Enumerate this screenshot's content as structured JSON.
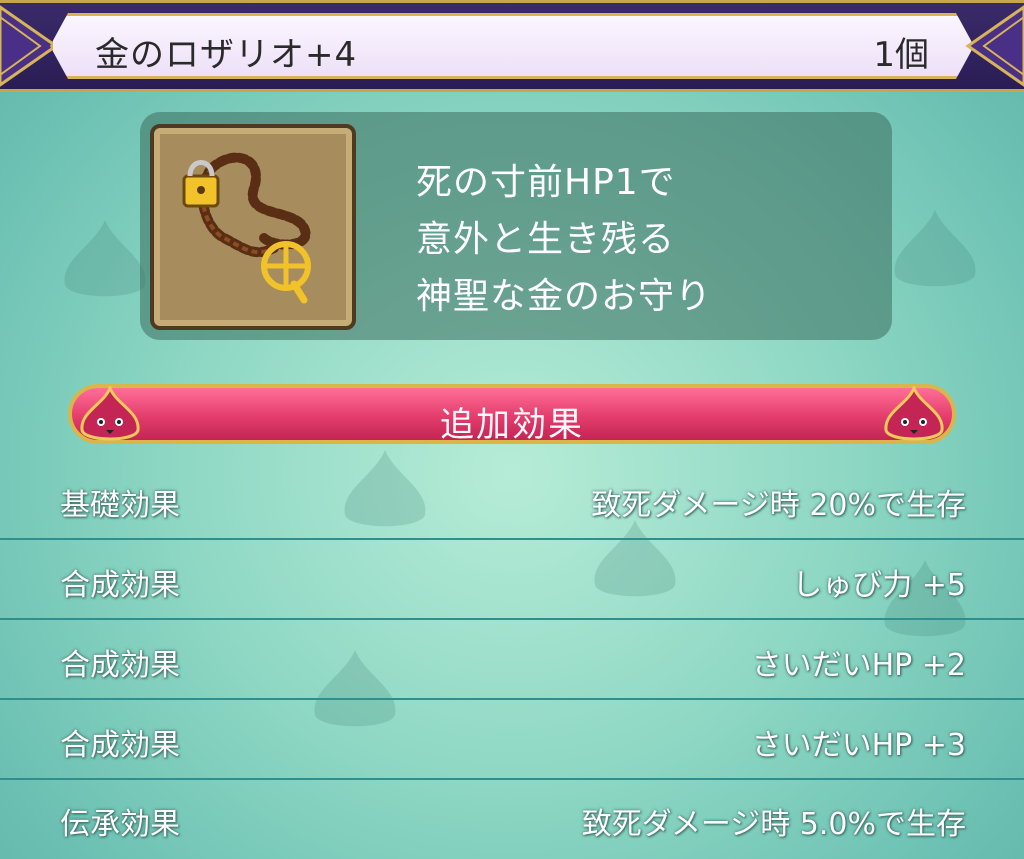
{
  "header": {
    "item_name": "金のロザリオ+4",
    "item_count": "1個"
  },
  "item": {
    "icon": "gold-rosary-icon",
    "description_lines": [
      "死の寸前HP1で",
      "意外と生き残る",
      "神聖な金のお守り"
    ]
  },
  "section": {
    "title": "追加効果"
  },
  "effects": [
    {
      "label": "基礎効果",
      "value": "致死ダメージ時 20%で生存"
    },
    {
      "label": "合成効果",
      "value": "しゅび力 +5"
    },
    {
      "label": "合成効果",
      "value": "さいだいHP +2"
    },
    {
      "label": "合成効果",
      "value": "さいだいHP +3"
    },
    {
      "label": "伝承効果",
      "value": "致死ダメージ時 5.0%で生存"
    }
  ],
  "colors": {
    "header_bg": "#2a1d55",
    "gold_trim": "#c9a64a",
    "ribbon": "#e33d6c",
    "background": "#8fd8c4"
  }
}
